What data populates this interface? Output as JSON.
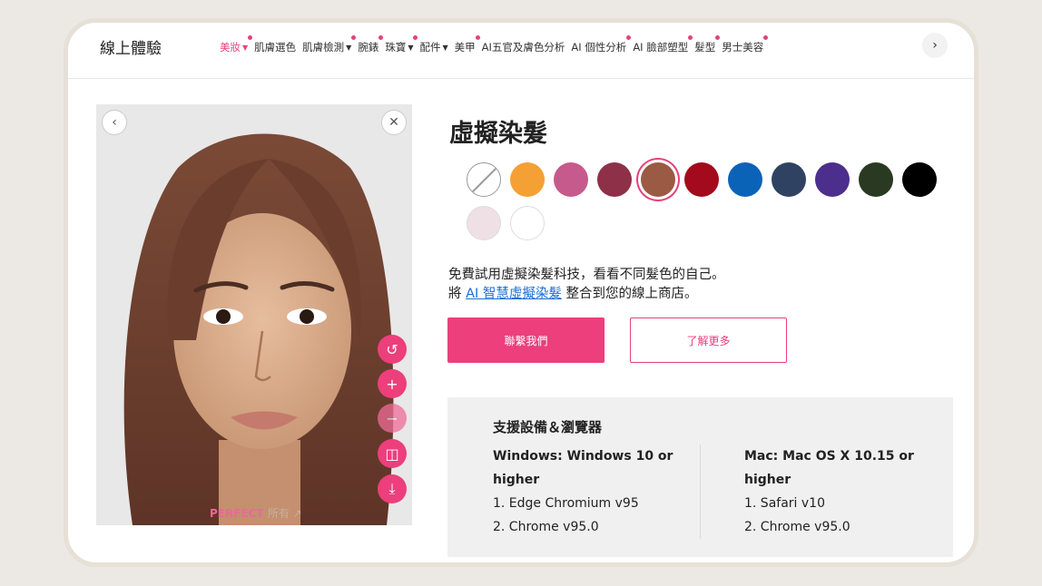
{
  "brand": "線上體驗",
  "nav": [
    {
      "label": "美妝",
      "caret": true,
      "dot": true,
      "active": true
    },
    {
      "label": "肌膚選色",
      "caret": false,
      "dot": false,
      "active": false
    },
    {
      "label": "肌膚檢測",
      "caret": true,
      "dot": true,
      "active": false
    },
    {
      "label": "腕錶",
      "caret": false,
      "dot": true,
      "active": false
    },
    {
      "label": "珠寶",
      "caret": true,
      "dot": true,
      "active": false
    },
    {
      "label": "配件",
      "caret": true,
      "dot": false,
      "active": false
    },
    {
      "label": "美甲",
      "caret": false,
      "dot": true,
      "active": false
    },
    {
      "label": "AI五官及膚色分析",
      "caret": false,
      "dot": false,
      "active": false
    },
    {
      "label": "AI 個性分析",
      "caret": false,
      "dot": true,
      "active": false
    },
    {
      "label": "AI 臉部塑型",
      "caret": false,
      "dot": true,
      "active": false
    },
    {
      "label": "髮型",
      "caret": false,
      "dot": true,
      "active": false
    },
    {
      "label": "男士美容",
      "caret": false,
      "dot": true,
      "active": false
    }
  ],
  "nav_next_icon": "›",
  "photo": {
    "back_icon": "‹",
    "close_icon": "✕",
    "tools": [
      {
        "name": "reset-icon",
        "glyph": "↺",
        "disabled": false
      },
      {
        "name": "zoom-in-icon",
        "glyph": "+",
        "disabled": false
      },
      {
        "name": "zoom-out-icon",
        "glyph": "−",
        "disabled": true
      },
      {
        "name": "compare-icon",
        "glyph": "◫",
        "disabled": false
      },
      {
        "name": "download-icon",
        "glyph": "⤓",
        "disabled": false
      }
    ],
    "watermark_brand": "PERFECT",
    "watermark_suffix": "所有 ↗"
  },
  "title": "虛擬染髮",
  "swatches": [
    {
      "color": "none",
      "selected": false
    },
    {
      "color": "#f5a034",
      "selected": false
    },
    {
      "color": "#c75a8c",
      "selected": false
    },
    {
      "color": "#8e3048",
      "selected": false
    },
    {
      "color": "#9a5a44",
      "selected": true
    },
    {
      "color": "#a30a1c",
      "selected": false
    },
    {
      "color": "#0b63b8",
      "selected": false
    },
    {
      "color": "#2f4262",
      "selected": false
    },
    {
      "color": "#4c2e8c",
      "selected": false
    },
    {
      "color": "#2a3a22",
      "selected": false
    },
    {
      "color": "#000000",
      "selected": false
    },
    {
      "color": "#efe0e6",
      "selected": false
    },
    {
      "color": "#ffffff",
      "selected": false
    }
  ],
  "desc": {
    "line1": "免費試用虛擬染髮科技，看看不同髮色的自己。",
    "line2_pre": "將 ",
    "line2_link": "AI 智慧虛擬染髮",
    "line2_post": " 整合到您的線上商店。"
  },
  "buttons": {
    "contact": "聯繫我們",
    "learn_more": "了解更多"
  },
  "support": {
    "title": "支援設備＆瀏覽器",
    "windows": {
      "head1": "Windows: Windows 10 or",
      "head2": "higher",
      "item1": "1. Edge Chromium v95",
      "item2": "2. Chrome v95.0"
    },
    "mac": {
      "head1": "Mac: Mac OS X 10.15 or",
      "head2": "higher",
      "item1": "1. Safari v10",
      "item2": "2. Chrome v95.0"
    }
  }
}
